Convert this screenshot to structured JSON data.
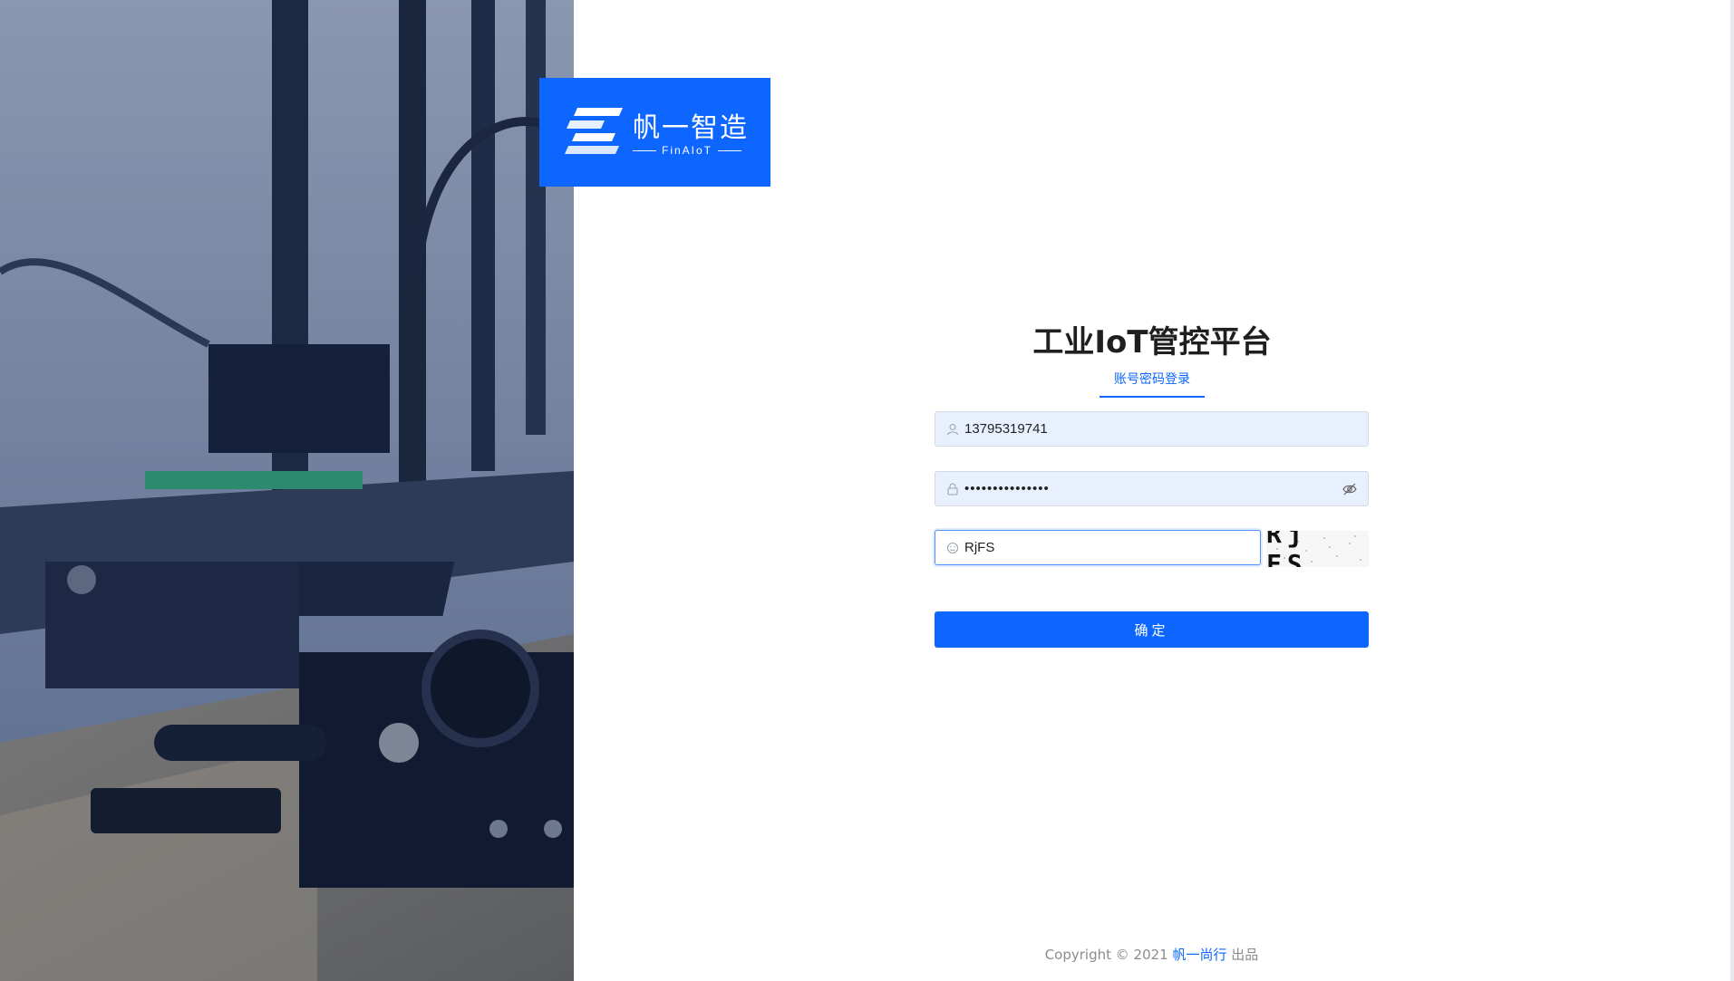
{
  "logo": {
    "brand_cn": "帆一智造",
    "brand_en": "FinAIoT",
    "brand_color": "#0c66ff"
  },
  "login": {
    "title": "工业IoT管控平台",
    "tab_label": "账号密码登录",
    "username": {
      "value": "13795319741",
      "icon": "user-icon"
    },
    "password": {
      "value": "•••••••••••••••",
      "icon": "lock-icon",
      "toggle_icon": "eye-hidden-icon"
    },
    "captcha": {
      "value": "RjFS",
      "icon": "captcha-icon",
      "image_text": "Rj FS"
    },
    "submit_label": "确定"
  },
  "footer": {
    "prefix": "Copyright © 2021 ",
    "link_text": "帆一尚行",
    "suffix": " 出品"
  },
  "hero": {
    "icon": "3d-printer-photo"
  }
}
